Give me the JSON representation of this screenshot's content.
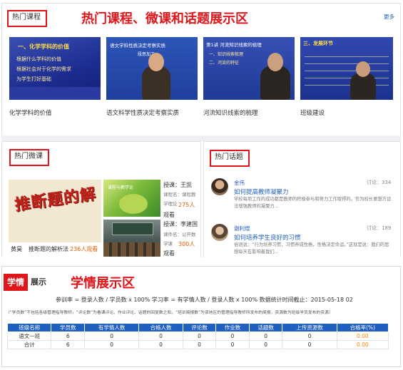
{
  "courses": {
    "tag": "热门课程",
    "title": "热门课程、微课和话题展示区",
    "more": "更多",
    "items": [
      {
        "caption": "化学学科的价值",
        "line1": "一、化学学科的价值",
        "line2": "根据什么学科的价值",
        "line3": "根据社会对于化学的需求",
        "line4": "为学生打好基础"
      },
      {
        "caption": "语文科学性质决定考察实质",
        "line1": "语文学科性质决定考察实质",
        "line2": "段思加工"
      },
      {
        "caption": "河流知识线索的梳理",
        "line1": "第1讲 河流知识线索的梳理",
        "line2": "一、知识线索梳理",
        "line3": "二、河流的特征"
      },
      {
        "caption": "班级建设",
        "line1": "三、发展环节"
      }
    ]
  },
  "microcourse": {
    "tag": "热门微课",
    "banner": "推断题的解",
    "main_author": "黄昊",
    "main_title": "推断题的解析法",
    "main_count": "236人观看",
    "items": [
      {
        "thumb_text": "课程与教学论",
        "author_label": "授课：王凯",
        "course_label": "课程名：课程教学理论",
        "count": "275人",
        "watch": "观看"
      },
      {
        "thumb_text": "",
        "author_label": "授课：李建国",
        "course_label": "课件名：公开数学课",
        "count": "300人",
        "watch": "观看"
      }
    ]
  },
  "topics": {
    "tag": "热门话题",
    "items": [
      {
        "user": "金伟",
        "stat": "讨论：334",
        "title": "如何提高教师凝聚力",
        "desc": "学校每项工作的成功都是教师的积极参与和努力工作取得的。作为校长要想方设法增强教师的凝聚力..."
      },
      {
        "user": "谢利煜",
        "stat": "讨论：189",
        "title": "如何培养学生良好的习惯",
        "desc": "俗语说：“行为培养习惯，习惯养成性格，性格决定命运。”这就是说：我们的思想每天在影响着我们..."
      }
    ]
  },
  "stats": {
    "tag_part1": "学情",
    "tag_part2": "展示",
    "title": "学情展示区",
    "formula_line": "参训率 = 登录人数 / 学员数 x 100%    学习率 = 有学情人数 / 登录人数 x 100%    数据统计时间截止：2015-05-18 02",
    "note_line": "（“学员数”不包括各级管理指导教师，“评论数”为看课评论、作业评论、话题的回复数之和，“培训简报数”为该地区的管理指导教师所发布的简报，资源数为班级学员发布的资源）",
    "headers": [
      "班级名称",
      "学员数",
      "有学情人数",
      "合格人数",
      "评论数",
      "作业数",
      "话题数",
      "上传资源数",
      "合格率(%)"
    ],
    "rows": [
      [
        "语文一班",
        "6",
        "0",
        "0",
        "0",
        "0",
        "0",
        "0",
        "0.00"
      ],
      [
        "合计",
        "6",
        "0",
        "0",
        "0",
        "0",
        "0",
        "0",
        "0.00"
      ]
    ]
  },
  "colors": {
    "accent_red": "#e0161b",
    "header_blue": "#1f5fbf",
    "orange": "#f08a00"
  }
}
